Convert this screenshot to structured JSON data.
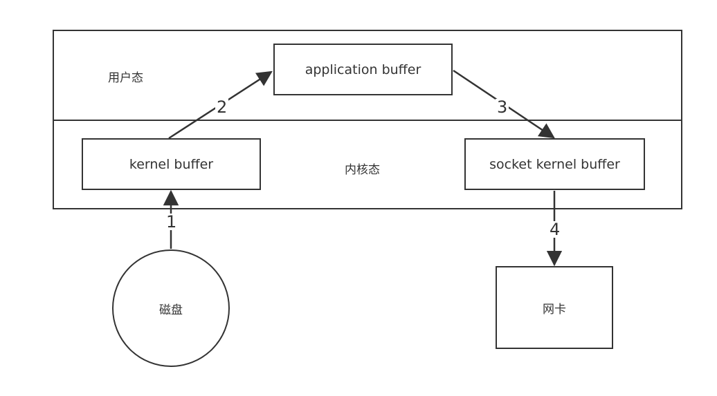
{
  "user_space": {
    "label": "用户态"
  },
  "kernel_space": {
    "label": "内核态"
  },
  "nodes": {
    "application_buffer": "application buffer",
    "kernel_buffer": "kernel buffer",
    "socket_kernel_buffer": "socket kernel buffer",
    "disk": "磁盘",
    "nic": "网卡"
  },
  "edges": [
    {
      "label": "1",
      "from": "disk",
      "to": "kernel_buffer"
    },
    {
      "label": "2",
      "from": "kernel_buffer",
      "to": "application_buffer"
    },
    {
      "label": "3",
      "from": "application_buffer",
      "to": "socket_kernel_buffer"
    },
    {
      "label": "4",
      "from": "socket_kernel_buffer",
      "to": "nic"
    }
  ],
  "colors": {
    "stroke": "#333333",
    "background": "#ffffff"
  }
}
